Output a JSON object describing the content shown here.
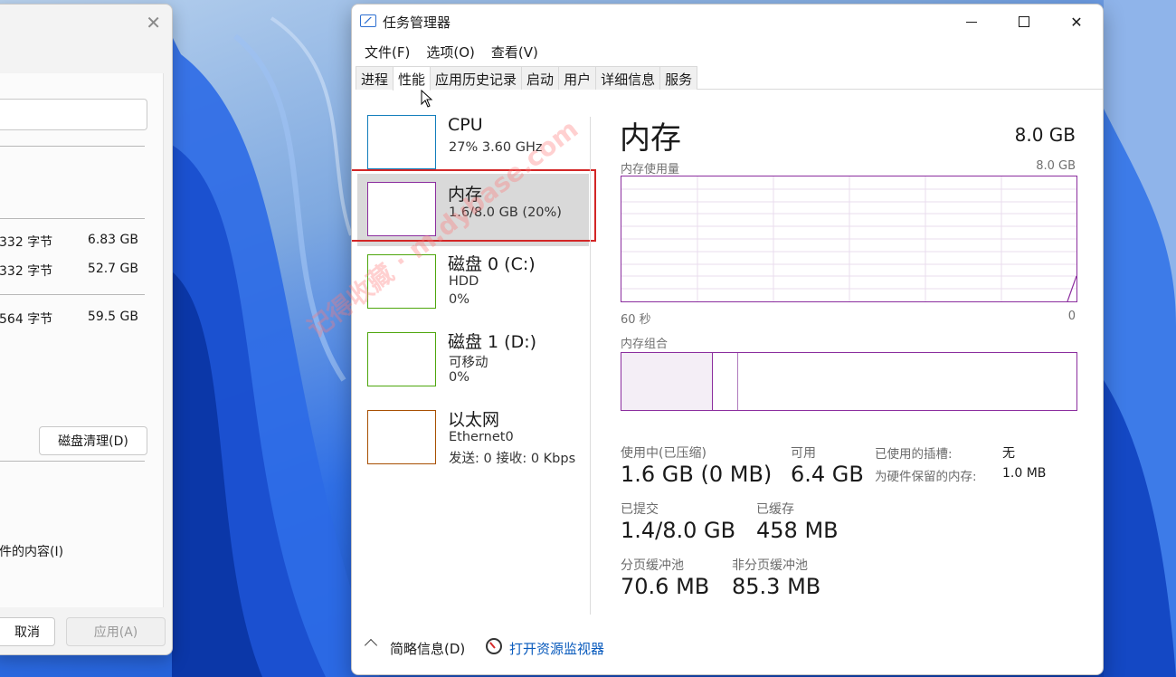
{
  "window": {
    "title": "任务管理器",
    "icon": "task-manager-icon",
    "controls": [
      "minimize-icon",
      "maximize-icon",
      "close-icon"
    ]
  },
  "menu": [
    "文件(F)",
    "选项(O)",
    "查看(V)"
  ],
  "tabs": [
    {
      "label": "进程",
      "active": false
    },
    {
      "label": "性能",
      "active": true
    },
    {
      "label": "应用历史记录",
      "active": false
    },
    {
      "label": "启动",
      "active": false
    },
    {
      "label": "用户",
      "active": false
    },
    {
      "label": "详细信息",
      "active": false
    },
    {
      "label": "服务",
      "active": false
    }
  ],
  "resources": [
    {
      "name": "CPU",
      "line1": "27% 3.60 GHz",
      "line2": "",
      "color": "#117dbb",
      "selected": false
    },
    {
      "name": "内存",
      "line1": "1.6/8.0 GB (20%)",
      "line2": "",
      "color": "#8b2d9e",
      "selected": true
    },
    {
      "name": "磁盘 0 (C:)",
      "line1": "HDD",
      "line2": "0%",
      "color": "#4da60c",
      "selected": false
    },
    {
      "name": "磁盘 1 (D:)",
      "line1": "可移动",
      "line2": "0%",
      "color": "#4da60c",
      "selected": false
    },
    {
      "name": "以太网",
      "line1": "Ethernet0",
      "line2": "发送: 0 接收: 0 Kbps",
      "color": "#a74f01",
      "selected": false
    }
  ],
  "memory": {
    "title": "内存",
    "total": "8.0 GB",
    "usage_label": "内存使用量",
    "usage_max": "8.0 GB",
    "time_left": "60 秒",
    "time_right": "0",
    "composition_label": "内存组合",
    "composition_in_use_fraction": 0.2,
    "composition_modified_fraction": 0.056,
    "stats": {
      "in_use_label": "使用中(已压缩)",
      "in_use": "1.6 GB (0 MB)",
      "available_label": "可用",
      "available": "6.4 GB",
      "committed_label": "已提交",
      "committed": "1.4/8.0 GB",
      "cached_label": "已缓存",
      "cached": "458 MB",
      "paged_label": "分页缓冲池",
      "paged": "70.6 MB",
      "nonpaged_label": "非分页缓冲池",
      "nonpaged": "85.3 MB",
      "slots_label": "已使用的插槽:",
      "slots": "无",
      "reserved_label": "为硬件保留的内存:",
      "reserved": "1.0 MB"
    }
  },
  "footer": {
    "brief": "简略信息(D)",
    "open_monitor": "打开资源监视器"
  },
  "props_dialog": {
    "rows": [
      {
        "a": "332 字节",
        "b": "6.83 GB"
      },
      {
        "a": "332 字节",
        "b": "52.7 GB"
      },
      {
        "a": "564 字节",
        "b": "59.5 GB"
      }
    ],
    "cleanup": "磁盘清理(D)",
    "content_opt": "件的内容(I)",
    "cancel": "取消",
    "apply": "应用(A)"
  },
  "watermark": "记得收藏 · m.dybase.com",
  "colors": {
    "memory": "#8b2d9e",
    "selection": "#d32626",
    "link": "#0a5bbd"
  }
}
